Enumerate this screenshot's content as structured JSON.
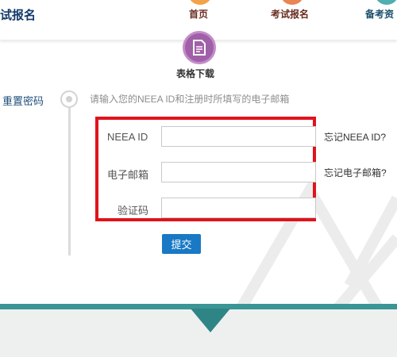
{
  "header": {
    "brand": "试报名",
    "nav": [
      {
        "label": "首页",
        "icon": "home-icon",
        "color": "#f3a24a"
      },
      {
        "label": "考试报名",
        "icon": "exam-registration-icon",
        "color": "#e98553"
      },
      {
        "label": "备考资",
        "icon": "study-materials-icon",
        "color": "#52aeb0"
      }
    ]
  },
  "download": {
    "label": "表格下载",
    "icon": "document-icon",
    "color": "#a060a8"
  },
  "sidebar": {
    "step_label": "重置密码"
  },
  "form": {
    "instruction": "请输入您的NEEA ID和注册时所填写的电子邮箱",
    "fields": [
      {
        "label": "NEEA ID",
        "value": "",
        "placeholder": "",
        "forgot_link": "忘记NEEA ID?"
      },
      {
        "label": "电子邮箱",
        "value": "",
        "placeholder": "",
        "forgot_link": "忘记电子邮箱?"
      },
      {
        "label": "验证码",
        "value": "",
        "placeholder": ""
      }
    ],
    "submit_label": "提交",
    "highlight_color": "#e0131b",
    "button_color": "#1979c4"
  },
  "footer": {
    "band_color": "#3a9595"
  }
}
